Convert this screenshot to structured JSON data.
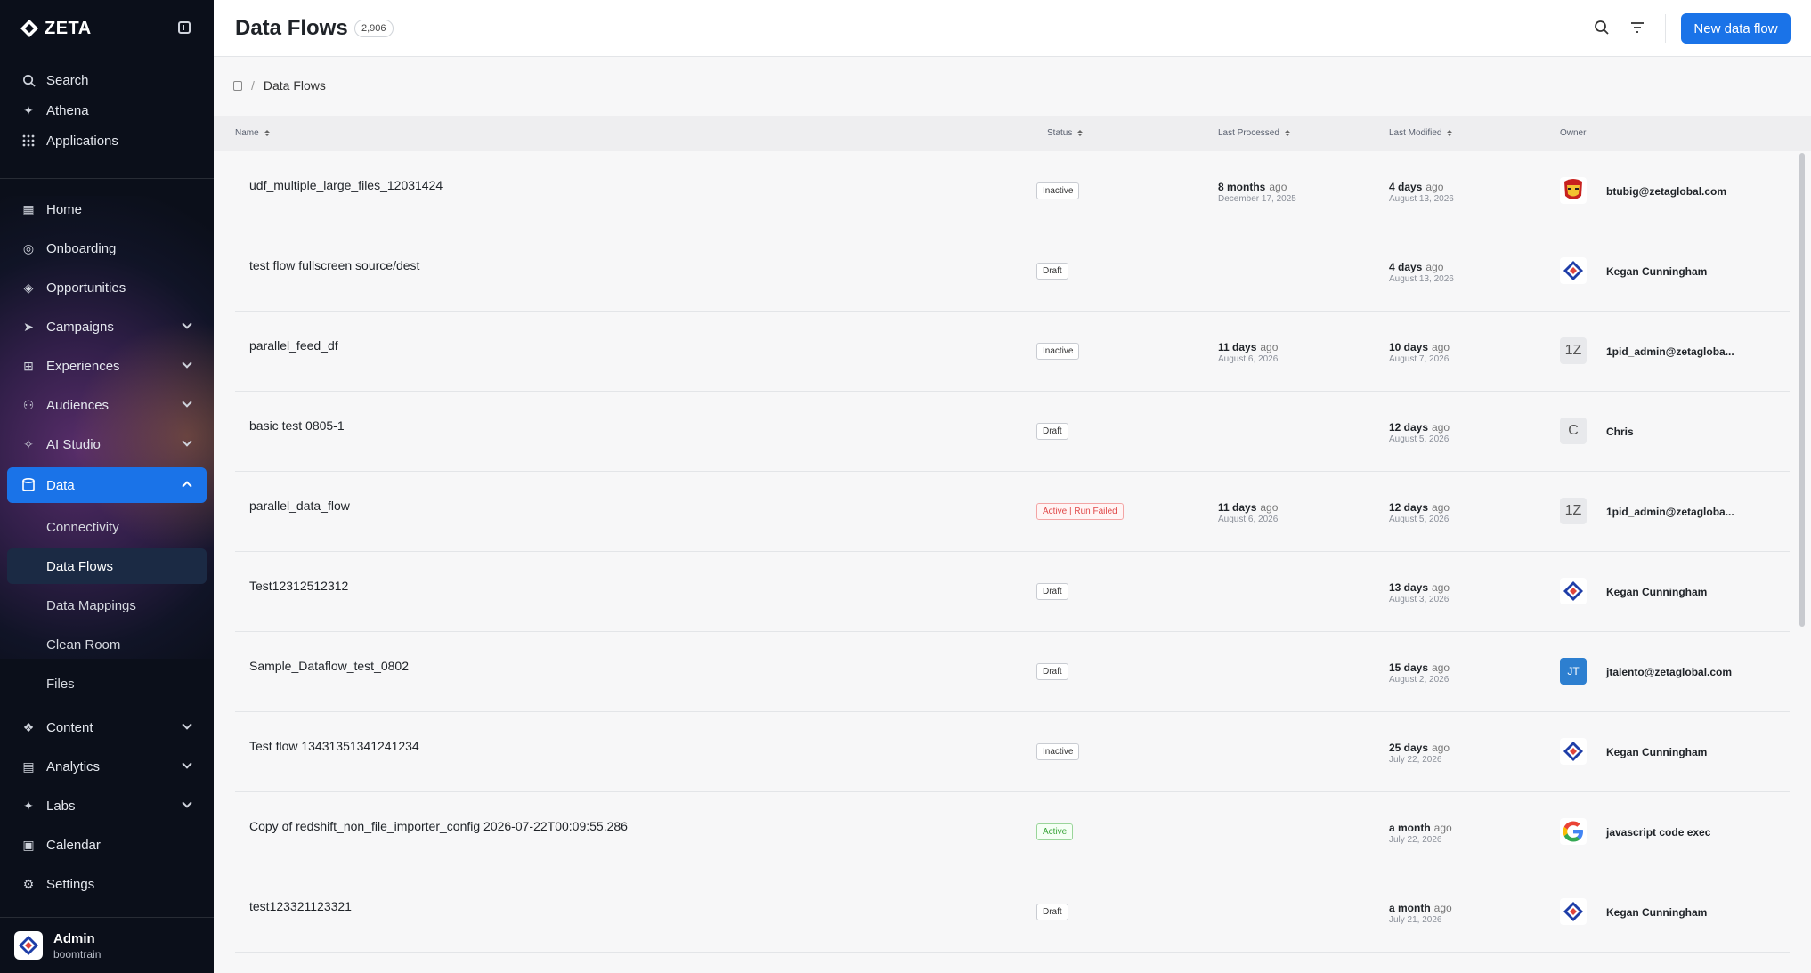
{
  "app": {
    "logo_text": "ZETA"
  },
  "sidebar": {
    "top": [
      {
        "label": "Search",
        "icon": "search-icon"
      },
      {
        "label": "Athena",
        "icon": "sparkle-icon"
      },
      {
        "label": "Applications",
        "icon": "grid-icon"
      }
    ],
    "items": [
      {
        "label": "Home",
        "icon": "home-icon"
      },
      {
        "label": "Onboarding",
        "icon": "compass-icon"
      },
      {
        "label": "Opportunities",
        "icon": "diamond-icon"
      },
      {
        "label": "Campaigns",
        "icon": "send-icon"
      },
      {
        "label": "Experiences",
        "icon": "sitemap-icon"
      },
      {
        "label": "Audiences",
        "icon": "audience-icon"
      },
      {
        "label": "AI Studio",
        "icon": "wand-icon"
      },
      {
        "label": "Data",
        "icon": "database-icon"
      }
    ],
    "data_sub": [
      "Connectivity",
      "Data Flows",
      "Data Mappings",
      "Clean Room",
      "Files"
    ],
    "bottom": [
      {
        "label": "Content",
        "icon": "content-icon"
      },
      {
        "label": "Analytics",
        "icon": "analytics-icon"
      },
      {
        "label": "Labs",
        "icon": "labs-icon"
      },
      {
        "label": "Calendar",
        "icon": "calendar-icon"
      },
      {
        "label": "Settings",
        "icon": "gear-icon"
      }
    ],
    "footer": {
      "name": "Admin",
      "sub": "boomtrain"
    }
  },
  "header": {
    "title": "Data Flows",
    "count": "2,906",
    "new_button": "New data flow"
  },
  "breadcrumb": {
    "current": "Data Flows"
  },
  "table": {
    "columns": {
      "name": "Name",
      "status": "Status",
      "last_processed": "Last Processed",
      "last_modified": "Last Modified",
      "owner": "Owner"
    },
    "rows": [
      {
        "name": "udf_multiple_large_files_12031424",
        "status": "Inactive",
        "processed_rel": "8 months",
        "processed_abs": "December 17, 2025",
        "modified_rel": "4 days",
        "modified_abs": "August 13, 2026",
        "owner": "btubig@zetaglobal.com",
        "avatar": "ironman",
        "avatar_text": ""
      },
      {
        "name": "test flow fullscreen source/dest",
        "status": "Draft",
        "processed_rel": "",
        "processed_abs": "",
        "modified_rel": "4 days",
        "modified_abs": "August 13, 2026",
        "owner": "Kegan Cunningham",
        "avatar": "zeta",
        "avatar_text": ""
      },
      {
        "name": "parallel_feed_df",
        "status": "Inactive",
        "processed_rel": "11 days",
        "processed_abs": "August 6, 2026",
        "modified_rel": "10 days",
        "modified_abs": "August 7, 2026",
        "owner": "1pid_admin@zetagloba...",
        "avatar": "gray",
        "avatar_text": "1Z"
      },
      {
        "name": "basic test 0805-1",
        "status": "Draft",
        "processed_rel": "",
        "processed_abs": "",
        "modified_rel": "12 days",
        "modified_abs": "August 5, 2026",
        "owner": "Chris",
        "avatar": "gray",
        "avatar_text": "C"
      },
      {
        "name": "parallel_data_flow",
        "status": "Active | Run Failed",
        "processed_rel": "11 days",
        "processed_abs": "August 6, 2026",
        "modified_rel": "12 days",
        "modified_abs": "August 5, 2026",
        "owner": "1pid_admin@zetagloba...",
        "avatar": "gray",
        "avatar_text": "1Z"
      },
      {
        "name": "Test12312512312",
        "status": "Draft",
        "processed_rel": "",
        "processed_abs": "",
        "modified_rel": "13 days",
        "modified_abs": "August 3, 2026",
        "owner": "Kegan Cunningham",
        "avatar": "zeta",
        "avatar_text": ""
      },
      {
        "name": "Sample_Dataflow_test_0802",
        "status": "Draft",
        "processed_rel": "",
        "processed_abs": "",
        "modified_rel": "15 days",
        "modified_abs": "August 2, 2026",
        "owner": "jtalento@zetaglobal.com",
        "avatar": "blue",
        "avatar_text": "JT"
      },
      {
        "name": "Test flow 13431351341241234",
        "status": "Inactive",
        "processed_rel": "",
        "processed_abs": "",
        "modified_rel": "25 days",
        "modified_abs": "July 22, 2026",
        "owner": "Kegan Cunningham",
        "avatar": "zeta",
        "avatar_text": ""
      },
      {
        "name": "Copy of redshift_non_file_importer_config 2026-07-22T00:09:55.286",
        "status": "Active",
        "processed_rel": "",
        "processed_abs": "",
        "modified_rel": "a month",
        "modified_abs": "July 22, 2026",
        "owner": "javascript code exec",
        "avatar": "google",
        "avatar_text": ""
      },
      {
        "name": "test123321123321",
        "status": "Draft",
        "processed_rel": "",
        "processed_abs": "",
        "modified_rel": "a month",
        "modified_abs": "July 21, 2026",
        "owner": "Kegan Cunningham",
        "avatar": "zeta",
        "avatar_text": ""
      }
    ],
    "ago": "ago"
  }
}
